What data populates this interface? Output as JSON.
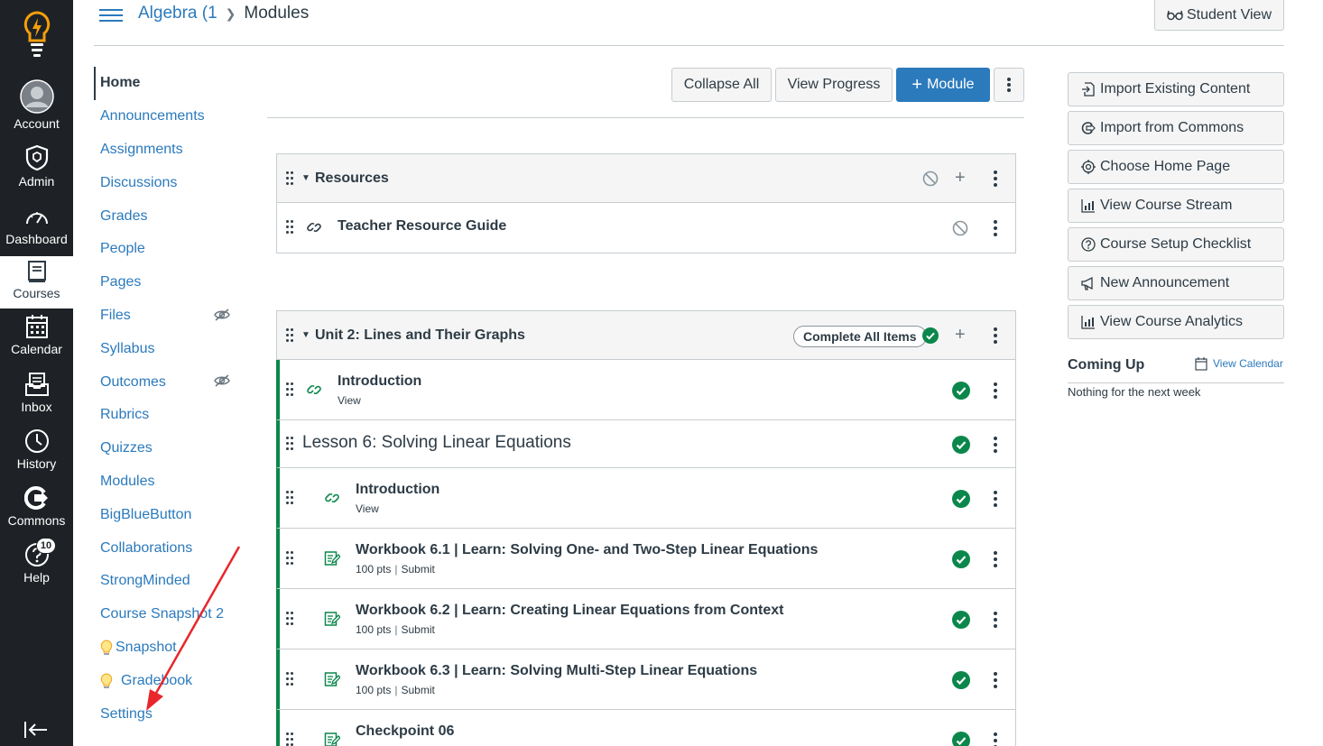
{
  "global_nav": {
    "items": [
      {
        "label": "Account",
        "icon": "avatar"
      },
      {
        "label": "Admin",
        "icon": "shield-icon"
      },
      {
        "label": "Dashboard",
        "icon": "speedometer-icon"
      },
      {
        "label": "Courses",
        "icon": "book-icon"
      },
      {
        "label": "Calendar",
        "icon": "calendar-icon"
      },
      {
        "label": "Inbox",
        "icon": "inbox-icon"
      },
      {
        "label": "History",
        "icon": "clock-icon"
      },
      {
        "label": "Commons",
        "icon": "commons-icon"
      },
      {
        "label": "Help",
        "icon": "help-icon",
        "badge": "10"
      }
    ]
  },
  "header": {
    "course": "Algebra (1",
    "page": "Modules",
    "student_view": "Student View"
  },
  "course_nav": [
    "Home",
    "Announcements",
    "Assignments",
    "Discussions",
    "Grades",
    "People",
    "Pages",
    "Files",
    "Syllabus",
    "Outcomes",
    "Rubrics",
    "Quizzes",
    "Modules",
    "BigBlueButton",
    "Collaborations",
    "StrongMinded",
    "Course Snapshot 2",
    "Snapshot",
    "Gradebook",
    "Settings"
  ],
  "toolbar": {
    "collapse_all": "Collapse All",
    "view_progress": "View Progress",
    "add_module": "Module"
  },
  "modules": {
    "resources": {
      "title": "Resources",
      "items": [
        {
          "title": "Teacher Resource Guide"
        }
      ]
    },
    "unit2": {
      "title": "Unit 2: Lines and Their Graphs",
      "complete_all": "Complete All Items",
      "items": [
        {
          "title": "Introduction",
          "sub": "View"
        },
        {
          "title": "Lesson 6: Solving Linear Equations"
        },
        {
          "title": "Introduction",
          "sub": "View"
        },
        {
          "title": "Workbook 6.1 | Learn: Solving One- and Two-Step Linear Equations",
          "pts": "100 pts",
          "req": "Submit"
        },
        {
          "title": "Workbook 6.2 | Learn: Creating Linear Equations from Context",
          "pts": "100 pts",
          "req": "Submit"
        },
        {
          "title": "Workbook 6.3 | Learn: Solving Multi-Step Linear Equations",
          "pts": "100 pts",
          "req": "Submit"
        },
        {
          "title": "Checkpoint 06"
        }
      ]
    }
  },
  "sidebar_right": {
    "buttons": [
      "Import Existing Content",
      "Import from Commons",
      "Choose Home Page",
      "View Course Stream",
      "Course Setup Checklist",
      "New Announcement",
      "View Course Analytics"
    ],
    "coming_up": "Coming Up",
    "view_calendar": "View Calendar",
    "empty": "Nothing for the next week"
  },
  "colors": {
    "nav_bg": "#1e2226",
    "link": "#2b7abc",
    "success": "#0b874b",
    "logo": "#f59e0b",
    "annotation_arrow": "#e8262b"
  }
}
